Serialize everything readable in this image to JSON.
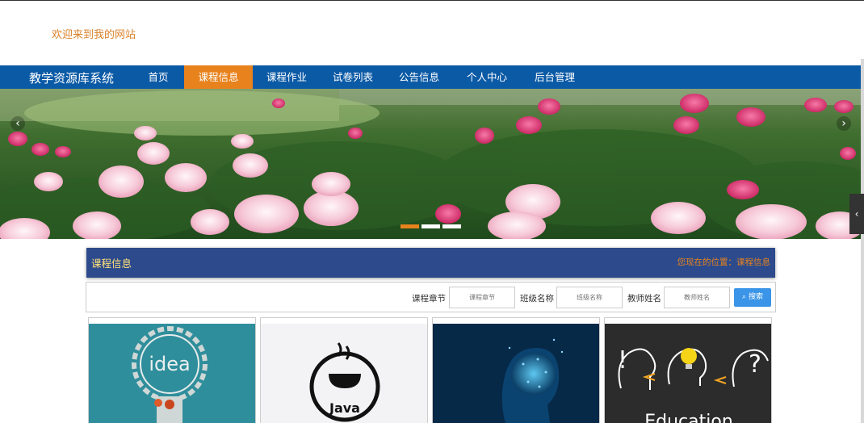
{
  "header": {
    "welcome": "欢迎来到我的网站"
  },
  "nav": {
    "brand": "教学资源库系统",
    "items": [
      {
        "label": "首页",
        "active": false
      },
      {
        "label": "课程信息",
        "active": true
      },
      {
        "label": "课程作业",
        "active": false
      },
      {
        "label": "试卷列表",
        "active": false
      },
      {
        "label": "公告信息",
        "active": false
      },
      {
        "label": "个人中心",
        "active": false
      },
      {
        "label": "后台管理",
        "active": false
      }
    ]
  },
  "carousel": {
    "prev_icon": "chevron-left-icon",
    "next_icon": "chevron-right-icon",
    "active_index": 0,
    "slides": 3
  },
  "section": {
    "title": "课程信息",
    "location": "您现在的位置：课程信息"
  },
  "search": {
    "fields": [
      {
        "label": "课程章节",
        "placeholder": "课程章节"
      },
      {
        "label": "班级名称",
        "placeholder": "班级名称"
      },
      {
        "label": "教师姓名",
        "placeholder": "教师姓名"
      }
    ],
    "button_label": "搜索"
  },
  "cards": [
    {
      "image": "idea-lightbulb",
      "text": "idea"
    },
    {
      "image": "java-logo",
      "text": "Java"
    },
    {
      "image": "ai-head"
    },
    {
      "image": "education-heads",
      "text": "Education"
    }
  ],
  "colors": {
    "nav_bg": "#0b5aa6",
    "accent": "#e8821c",
    "section_bg": "#2d4b8c",
    "button": "#3a95e8"
  }
}
